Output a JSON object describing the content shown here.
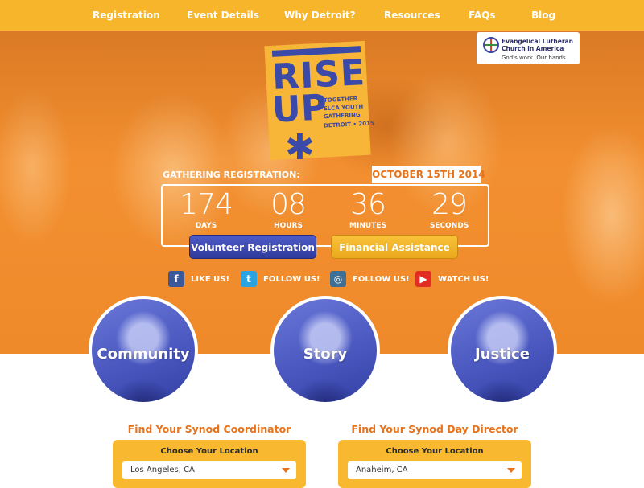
{
  "nav": {
    "items": [
      "Registration",
      "Event Details",
      "Why Detroit?",
      "Resources",
      "FAQs",
      "Blog"
    ]
  },
  "elca": {
    "line1": "Evangelical Lutheran",
    "line2": "Church in America",
    "tagline": "God's work. Our hands."
  },
  "logo": {
    "rise": "RISE",
    "up": "UP",
    "sub1": "TOGETHER",
    "sub2": "ELCA YOUTH",
    "sub3": "GATHERING",
    "sub4": "DETROIT • 2015"
  },
  "countdown": {
    "label": "GATHERING REGISTRATION:",
    "date": "OCTOBER 15TH 2014",
    "cells": [
      {
        "value": "174",
        "unit": "DAYS"
      },
      {
        "value": "08",
        "unit": "HOURS"
      },
      {
        "value": "36",
        "unit": "MINUTES"
      },
      {
        "value": "29",
        "unit": "SECONDS"
      }
    ]
  },
  "buttons": {
    "volunteer": "Volunteer Registration",
    "financial": "Financial Assistance"
  },
  "social": [
    {
      "icon": "facebook-icon",
      "glyph": "f",
      "color": "#3b5998",
      "label": "LIKE US!"
    },
    {
      "icon": "twitter-icon",
      "glyph": "t",
      "color": "#2aa3e0",
      "label": "FOLLOW US!"
    },
    {
      "icon": "instagram-icon",
      "glyph": "◎",
      "color": "#3f6f94",
      "label": "FOLLOW US!"
    },
    {
      "icon": "youtube-icon",
      "glyph": "▶",
      "color": "#e22d24",
      "label": "WATCH US!"
    }
  ],
  "circles": [
    "Community",
    "Story",
    "Justice"
  ],
  "synod": {
    "coordinator": {
      "title": "Find Your Synod Coordinator",
      "card_title": "Choose Your Location",
      "value": "Los Angeles, CA"
    },
    "director": {
      "title": "Find Your Synod Day Director",
      "card_title": "Choose Your Location",
      "value": "Anaheim, CA"
    }
  },
  "colors": {
    "nav": "#f6b52a",
    "hero": "#f08a2c",
    "accent_orange": "#e6731d",
    "blue": "#3b4aa8",
    "gold": "#f8b830"
  }
}
